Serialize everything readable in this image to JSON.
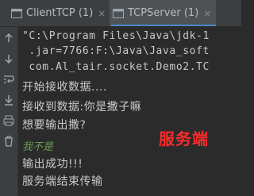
{
  "tabs": [
    {
      "label": "ClientTCP (1)",
      "close": "×"
    },
    {
      "label": "TCPServer (1)",
      "close": "×"
    }
  ],
  "console": {
    "command_lines": [
      "\"C:\\Program Files\\Java\\jdk-1",
      " .jar=7766:F:\\Java\\Java_soft",
      " com.Al_tair.socket.Demo2.TC"
    ],
    "output_lines": [
      "开始接收数据....",
      "接收到数据:你是撒子嘛",
      "想要输出撒?"
    ],
    "user_input": "我不是",
    "final_lines": [
      "输出成功!!!",
      "服务端结束传输"
    ]
  },
  "overlay_label": "服务端",
  "gutter_icons": [
    "up-arrow-icon",
    "down-arrow-icon",
    "wrap-icon",
    "scroll-end-icon",
    "print-icon",
    "trash-icon"
  ],
  "colors": {
    "accent": "#4a88c7",
    "overlay": "#ff2a2a",
    "user_input": "#6a9955"
  }
}
